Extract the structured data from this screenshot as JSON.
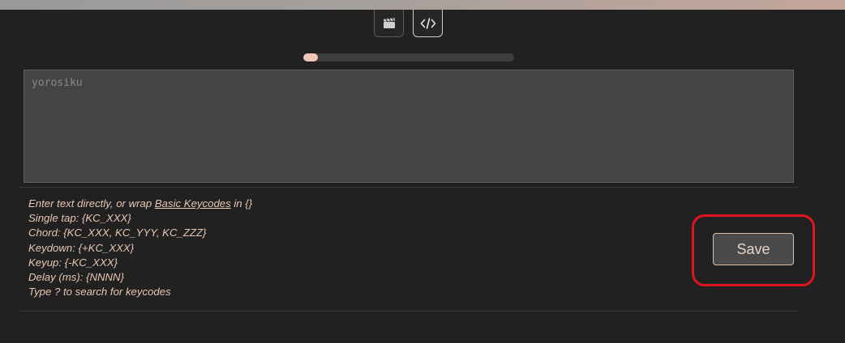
{
  "toolbar": {
    "buttons": [
      {
        "icon": "clapperboard-icon",
        "active": false
      },
      {
        "icon": "code-icon",
        "active": true
      }
    ]
  },
  "progress": {
    "value": 0.07
  },
  "macro_editor": {
    "placeholder": "yorosiku",
    "value": ""
  },
  "help": {
    "line1_prefix": "Enter text directly, or wrap ",
    "line1_link": "Basic Keycodes",
    "line1_suffix": " in {}",
    "single_tap": "Single tap: {KC_XXX}",
    "chord": "Chord: {KC_XXX, KC_YYY, KC_ZZZ}",
    "keydown": "Keydown: {+KC_XXX}",
    "keyup": "Keyup: {-KC_XXX}",
    "delay": "Delay (ms): {NNNN}",
    "search": "Type ? to search for keycodes"
  },
  "actions": {
    "save_label": "Save"
  },
  "colors": {
    "accent": "#f0c6b8",
    "help_text": "#e8c6b4",
    "highlight": "#e0141e",
    "background": "#212121"
  }
}
